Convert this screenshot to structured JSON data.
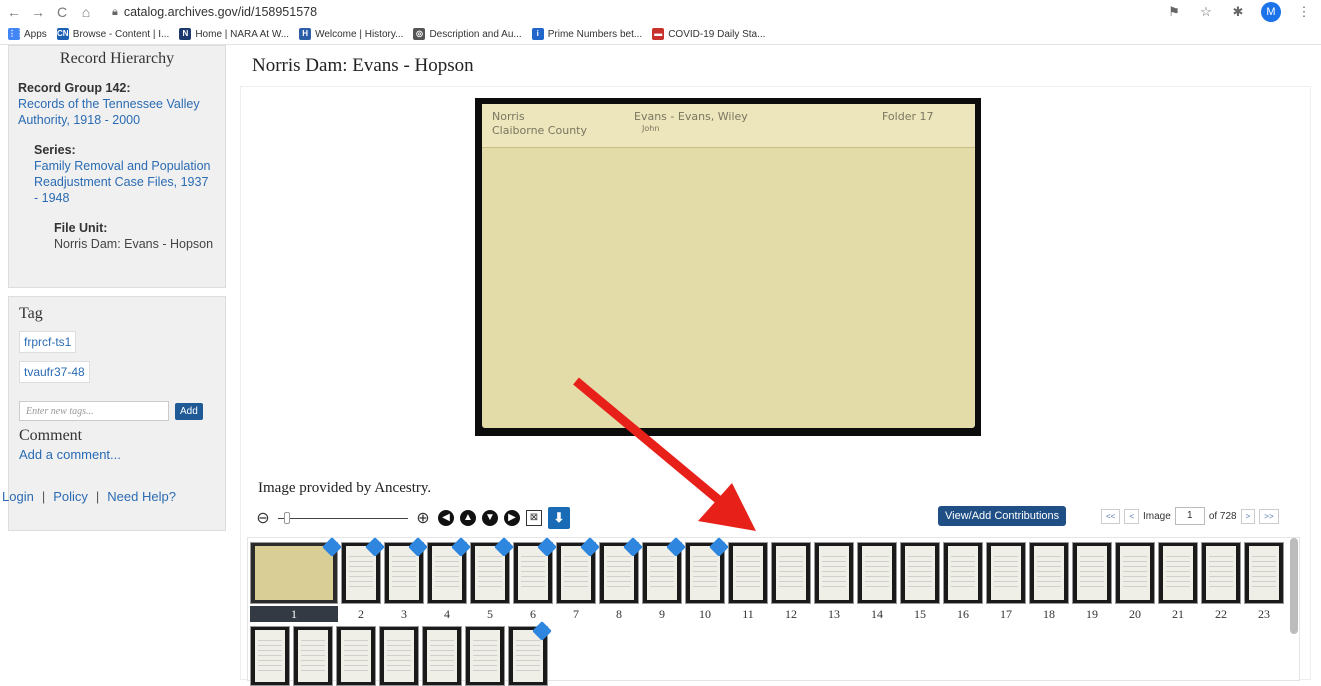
{
  "browser": {
    "nav": [
      "←",
      "→",
      "C",
      "⌂"
    ],
    "url": "catalog.archives.gov/id/158951578",
    "avatar_initial": "M",
    "bookmarks": [
      {
        "label": "Apps",
        "icon": "apps-grid-icon",
        "color": "#4285f4",
        "glyph": "⋮⋮"
      },
      {
        "label": "Browse - Content | I...",
        "icon": "content-icon",
        "color": "#1a5fb4",
        "glyph": "CN"
      },
      {
        "label": "Home | NARA At W...",
        "icon": "nara-icon",
        "color": "#1d3a6e",
        "glyph": "N"
      },
      {
        "label": "Welcome | History...",
        "icon": "history-icon",
        "color": "#2c5fa8",
        "glyph": "H"
      },
      {
        "label": "Description and Au...",
        "icon": "globe-icon",
        "color": "#555555",
        "glyph": "◎"
      },
      {
        "label": "Prime Numbers bet...",
        "icon": "info-icon",
        "color": "#2266cc",
        "glyph": "i"
      },
      {
        "label": "COVID-19 Daily Sta...",
        "icon": "flag-icon",
        "color": "#c8302c",
        "glyph": "▬"
      }
    ]
  },
  "hierarchy": {
    "heading": "Record Hierarchy",
    "record_group_label": "Record Group 142:",
    "record_group_link": "Records of the Tennessee Valley Authority, 1918 - 2000",
    "series_label": "Series:",
    "series_link": "Family Removal and Population Readjustment Case Files, 1937 - 1948",
    "file_unit_label": "File Unit:",
    "file_unit_value": "Norris Dam: Evans - Hopson"
  },
  "tags": {
    "heading": "Tag",
    "items": [
      "frprcf-ts1",
      "tvaufr37-48"
    ],
    "input_placeholder": "Enter new tags...",
    "add_label": "Add"
  },
  "comment": {
    "heading": "Comment",
    "add_link": "Add a comment..."
  },
  "footer_links": [
    "Login",
    "Policy",
    "Need Help?"
  ],
  "page_title": "Norris Dam: Evans - Hopson",
  "folder_text": {
    "left_top": "Norris",
    "left_bottom": "Claiborne County",
    "middle_top": "Evans - Evans, Wiley",
    "middle_bottom": "John",
    "right": "Folder 17"
  },
  "viewer": {
    "provided_by": "Image provided by Ancestry.",
    "contributions_button": "View/Add Contributions",
    "pager": {
      "first": "<<",
      "prev": "<",
      "image_label": "Image",
      "current": "1",
      "total_label": "of 728",
      "next": ">",
      "last": ">>"
    },
    "zoom_level": 0.05
  },
  "thumbnails": {
    "row1": [
      "1",
      "2",
      "3",
      "4",
      "5",
      "6",
      "7",
      "8",
      "9",
      "10",
      "11",
      "12",
      "13",
      "14",
      "15",
      "16",
      "17",
      "18",
      "19",
      "20",
      "21",
      "22",
      "23"
    ],
    "badged_row1": [
      1,
      2,
      3,
      4,
      5,
      6,
      7,
      8,
      9,
      10
    ],
    "row2_count": 7,
    "badged_row2": [
      7
    ],
    "active": "1"
  },
  "colors": {
    "link": "#2a6bb3",
    "button": "#1f4f85",
    "annotation_arrow": "#e8201a"
  }
}
